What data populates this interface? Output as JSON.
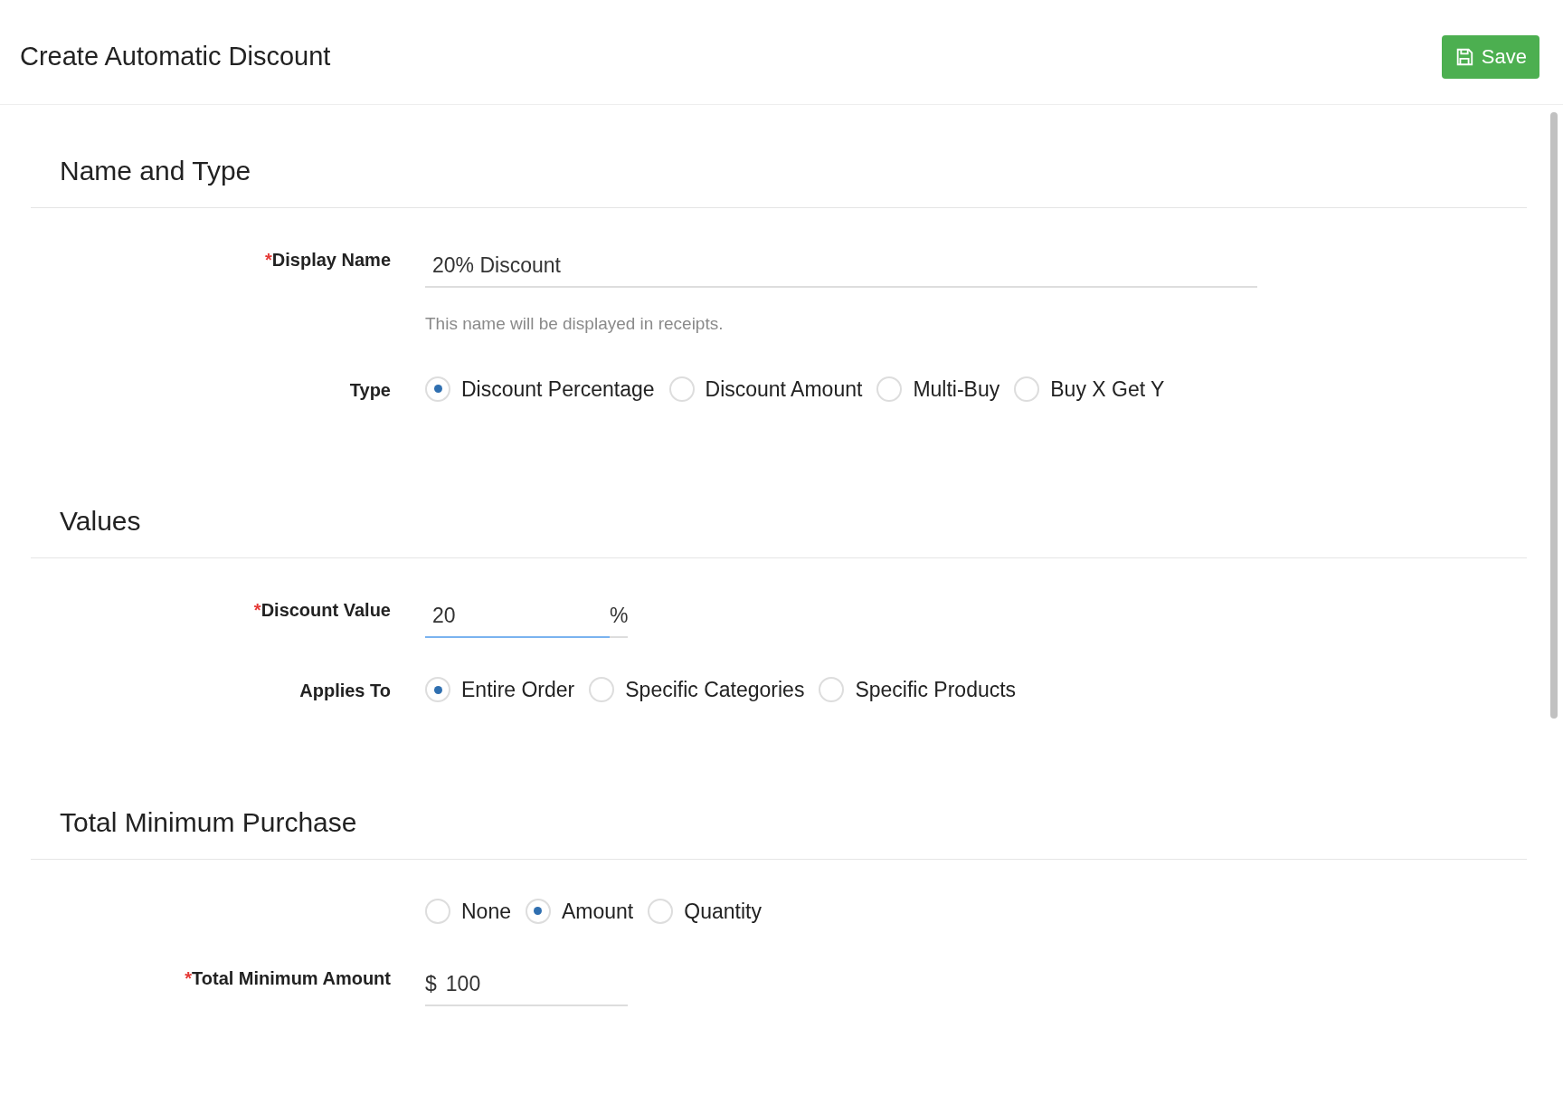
{
  "header": {
    "title": "Create Automatic Discount",
    "save_button": "Save"
  },
  "sections": [
    {
      "title": "Name and Type",
      "fields": [
        {
          "kind": "text",
          "required_mark": "*",
          "label": "Display Name",
          "value": "20% Discount",
          "helper": "This name will be displayed in receipts.",
          "focused": false
        },
        {
          "kind": "radio",
          "label": "Type",
          "options": [
            {
              "label": "Discount Percentage",
              "selected": true
            },
            {
              "label": "Discount Amount",
              "selected": false
            },
            {
              "label": "Multi-Buy",
              "selected": false
            },
            {
              "label": "Buy X Get Y",
              "selected": false
            }
          ]
        }
      ]
    },
    {
      "title": "Values",
      "fields": [
        {
          "kind": "suffix",
          "required_mark": "*",
          "label": "Discount Value",
          "value": "20",
          "suffix": "%",
          "focused": true
        },
        {
          "kind": "radio",
          "label": "Applies To",
          "options": [
            {
              "label": "Entire Order",
              "selected": true
            },
            {
              "label": "Specific Categories",
              "selected": false
            },
            {
              "label": "Specific Products",
              "selected": false
            }
          ]
        }
      ]
    },
    {
      "title": "Total Minimum Purchase",
      "fields": [
        {
          "kind": "radio",
          "options": [
            {
              "label": "None",
              "selected": false
            },
            {
              "label": "Amount",
              "selected": true
            },
            {
              "label": "Quantity",
              "selected": false
            }
          ]
        },
        {
          "kind": "prefix",
          "required_mark": "*",
          "label": "Total Minimum Amount",
          "prefix": "$",
          "value": "100",
          "focused": false
        }
      ]
    }
  ]
}
